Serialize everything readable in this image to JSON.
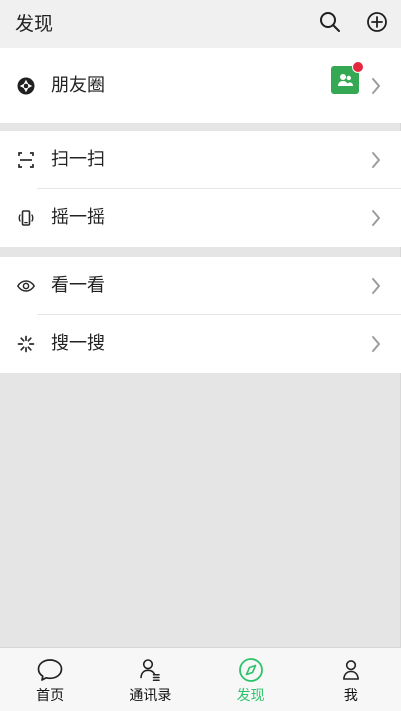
{
  "header": {
    "title": "发现",
    "search_icon": "search-icon",
    "add_icon": "plus-circle-icon"
  },
  "sections": [
    {
      "items": [
        {
          "label": "朋友圈",
          "icon": "moments-icon",
          "badge_icon": "contacts-badge-icon",
          "unread_dot": true
        }
      ]
    },
    {
      "items": [
        {
          "label": "扫一扫",
          "icon": "scan-icon"
        },
        {
          "label": "摇一摇",
          "icon": "shake-icon"
        }
      ]
    },
    {
      "items": [
        {
          "label": "看一看",
          "icon": "eye-icon"
        },
        {
          "label": "搜一搜",
          "icon": "search-spark-icon"
        }
      ]
    }
  ],
  "bottom_nav": [
    {
      "label": "首页",
      "icon": "chat-bubble-icon"
    },
    {
      "label": "通讯录",
      "icon": "contacts-icon"
    },
    {
      "label": "发现",
      "icon": "compass-icon",
      "active": true
    },
    {
      "label": "我",
      "icon": "person-icon"
    }
  ],
  "colors": {
    "accent": "#2dc36a",
    "badge_green": "#34a853",
    "unread_red": "#e5283f",
    "background": "#e5e5e5",
    "header_bg": "#f0f0f0"
  }
}
